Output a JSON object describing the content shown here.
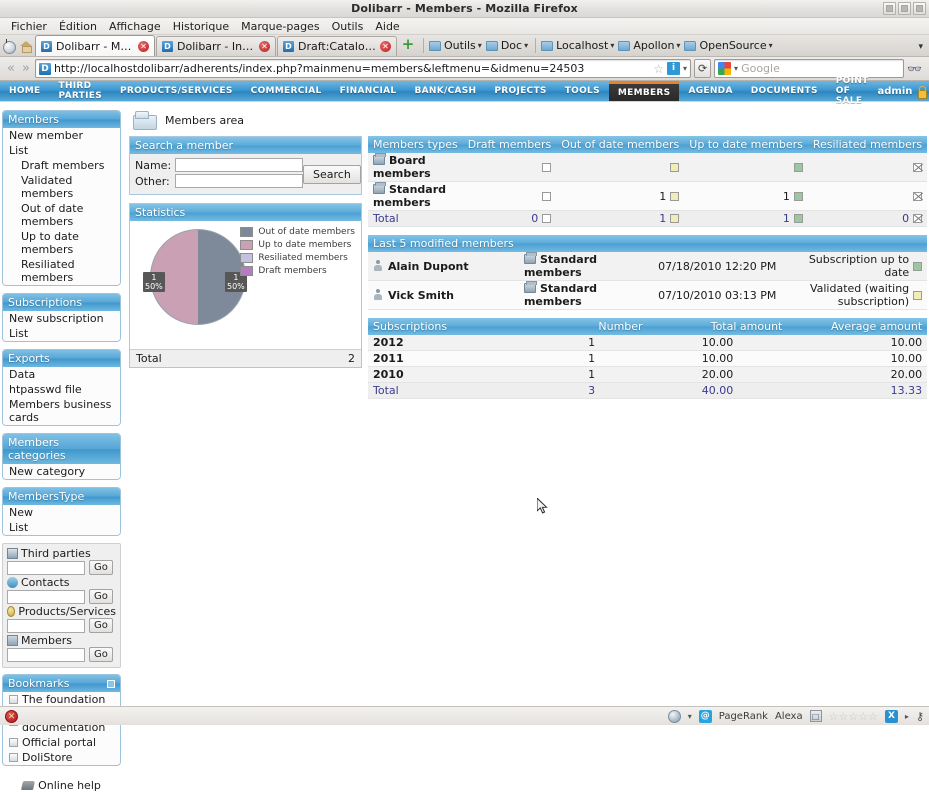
{
  "window": {
    "title": "Dolibarr - Members - Mozilla Firefox",
    "buttons": [
      "minimize",
      "maximize",
      "close"
    ]
  },
  "menubar": {
    "items": [
      {
        "label": "Fichier",
        "accel": "F"
      },
      {
        "label": "Édition",
        "accel": "n"
      },
      {
        "label": "Affichage",
        "accel": "A"
      },
      {
        "label": "Historique",
        "accel": "H"
      },
      {
        "label": "Marque-pages",
        "accel": "M"
      },
      {
        "label": "Outils",
        "accel": "O"
      },
      {
        "label": "Aide",
        "accel": "e"
      }
    ]
  },
  "tabbar": {
    "tabs": [
      {
        "label": "Dolibarr - Memb...",
        "active": true,
        "favicon": "D",
        "close": "✕"
      },
      {
        "label": "Dolibarr - Invoic...",
        "active": false,
        "favicon": "D",
        "close": "✕"
      },
      {
        "label": "Draft:Catalogue...",
        "active": false,
        "favicon": "D",
        "close": "✕"
      }
    ],
    "new_tab_label": "+",
    "bookmark_folders": [
      {
        "label": "Outils"
      },
      {
        "label": "Doc"
      },
      {
        "label": "Localhost"
      },
      {
        "label": "Apollon"
      },
      {
        "label": "OpenSource"
      }
    ],
    "overflow_label": "▾"
  },
  "urlbar": {
    "back": "«",
    "forward": "»",
    "favicon": "D",
    "url": "http://localhostdolibarr/adherents/index.php?mainmenu=members&leftmenu=&idmenu=24503",
    "star": "☆",
    "identity_badge": "i",
    "caret": "▾",
    "reload": "⟳",
    "search_placeholder": "Google",
    "search_value": "",
    "search_caret": "▾",
    "binoculars": "♂"
  },
  "dolibarr_menu": {
    "items": [
      {
        "label": "HOME",
        "active": false
      },
      {
        "label": "THIRD PARTIES",
        "active": false
      },
      {
        "label": "PRODUCTS/SERVICES",
        "active": false
      },
      {
        "label": "COMMERCIAL",
        "active": false
      },
      {
        "label": "FINANCIAL",
        "active": false
      },
      {
        "label": "BANK/CASH",
        "active": false
      },
      {
        "label": "PROJECTS",
        "active": false
      },
      {
        "label": "TOOLS",
        "active": false
      },
      {
        "label": "MEMBERS",
        "active": true
      },
      {
        "label": "AGENDA",
        "active": false
      },
      {
        "label": "DOCUMENTS",
        "active": false
      },
      {
        "label": "POINT OF SALE",
        "active": false
      }
    ],
    "user": "admin"
  },
  "sidebar": {
    "blocks": [
      {
        "title": "Members",
        "items": [
          {
            "label": "New member",
            "sub": false
          },
          {
            "label": "List",
            "sub": false
          },
          {
            "label": "Draft members",
            "sub": true
          },
          {
            "label": "Validated members",
            "sub": true
          },
          {
            "label": "Out of date members",
            "sub": true
          },
          {
            "label": "Up to date members",
            "sub": true
          },
          {
            "label": "Resiliated members",
            "sub": true
          }
        ]
      },
      {
        "title": "Subscriptions",
        "items": [
          {
            "label": "New subscription",
            "sub": false
          },
          {
            "label": "List",
            "sub": false
          }
        ]
      },
      {
        "title": "Exports",
        "items": [
          {
            "label": "Data",
            "sub": false
          },
          {
            "label": "htpasswd file",
            "sub": false
          },
          {
            "label": "Members business cards",
            "sub": false
          }
        ]
      },
      {
        "title": "Members categories",
        "items": [
          {
            "label": "New category",
            "sub": false
          }
        ]
      },
      {
        "title": "MembersType",
        "items": [
          {
            "label": "New",
            "sub": false
          },
          {
            "label": "List",
            "sub": false
          }
        ]
      }
    ],
    "quick_search": [
      {
        "label": "Third parties",
        "icon": "building-icon",
        "value": "",
        "go": "Go"
      },
      {
        "label": "Contacts",
        "icon": "contact-icon",
        "value": "",
        "go": "Go"
      },
      {
        "label": "Products/Services",
        "icon": "product-icon",
        "value": "",
        "go": "Go"
      },
      {
        "label": "Members",
        "icon": "member-icon",
        "value": "",
        "go": "Go"
      }
    ],
    "bookmarks": {
      "title": "Bookmarks",
      "items": [
        {
          "label": "The foundation"
        },
        {
          "label": "Online documentation"
        },
        {
          "label": "Official portal"
        },
        {
          "label": "DoliStore"
        }
      ]
    },
    "online_help": "Online help"
  },
  "main": {
    "area_title": "Members area",
    "search_panel": {
      "title": "Search a member",
      "name_label": "Name:",
      "name_value": "",
      "other_label": "Other:",
      "other_value": "",
      "search_button": "Search"
    },
    "statistics": {
      "title": "Statistics",
      "total_label": "Total",
      "total_value": "2"
    },
    "members_types": {
      "columns": [
        "Members types",
        "Draft members",
        "Out of date members",
        "Up to date members",
        "Resiliated members"
      ],
      "rows": [
        {
          "name": "Board members",
          "draft": "",
          "out_of_date": "",
          "up_to_date": "",
          "resiliated": ""
        },
        {
          "name": "Standard members",
          "draft": "",
          "out_of_date": "1",
          "up_to_date": "1",
          "resiliated": ""
        }
      ],
      "total": {
        "name": "Total",
        "draft": "0",
        "out_of_date": "1",
        "up_to_date": "1",
        "resiliated": "0"
      }
    },
    "last_modified": {
      "title": "Last 5 modified members",
      "rows": [
        {
          "name": "Alain Dupont",
          "type": "Standard members",
          "date": "07/18/2010 12:20 PM",
          "status": "Subscription up to date",
          "status_color": "uptodate"
        },
        {
          "name": "Vick Smith",
          "type": "Standard members",
          "date": "07/10/2010 03:13 PM",
          "status": "Validated (waiting subscription)",
          "status_color": "outofdate"
        }
      ]
    },
    "subscriptions": {
      "columns": [
        "Subscriptions",
        "Number",
        "Total amount",
        "Average amount"
      ],
      "rows": [
        {
          "year": "2012",
          "number": "1",
          "total": "10.00",
          "average": "10.00"
        },
        {
          "year": "2011",
          "number": "1",
          "total": "10.00",
          "average": "10.00"
        },
        {
          "year": "2010",
          "number": "1",
          "total": "20.00",
          "average": "20.00"
        }
      ],
      "total": {
        "year": "Total",
        "number": "3",
        "total": "40.00",
        "average": "13.33"
      }
    }
  },
  "chart_data": {
    "type": "pie",
    "title": "Statistics",
    "categories": [
      "Out of date members",
      "Up to date members",
      "Resiliated members",
      "Draft members"
    ],
    "values": [
      1,
      1,
      0,
      0
    ],
    "percents": [
      "50%",
      "50%",
      "",
      ""
    ],
    "labels": [
      "1",
      "1",
      "",
      ""
    ],
    "colors": [
      "#7e8a99",
      "#c9a0b4",
      "#c2c2e0",
      "#b47fc0"
    ],
    "legend_position": "right",
    "total": 2
  },
  "statusbar": {
    "error_icon": "✕",
    "globe_caret": "▾",
    "at_badge": "@",
    "pagerank": "PageRank",
    "alexa": "Alexa",
    "square_badge": "□",
    "stars": "☆☆☆☆☆",
    "x_badge": "X",
    "x_caret": "▸",
    "plug": "⚷"
  }
}
